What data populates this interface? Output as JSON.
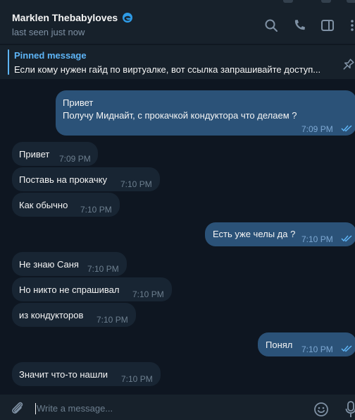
{
  "header": {
    "chat_name": "Marklen Thebabyloves",
    "status": "last seen just now"
  },
  "pinned": {
    "title": "Pinned message",
    "text": "Если кому нужен гайд по виртуалке, вот ссылка запрашивайте доступ..."
  },
  "messages": [
    {
      "direction": "out",
      "lines": [
        "Привет",
        "Получу Миднайт, с прокачкой кондуктора что делаем ?"
      ],
      "time": "7:09 PM",
      "read": true
    },
    {
      "direction": "in",
      "lines": [
        "Привет"
      ],
      "time": "7:09 PM"
    },
    {
      "direction": "in",
      "lines": [
        "Поставь на прокачку"
      ],
      "time": "7:10 PM"
    },
    {
      "direction": "in",
      "lines": [
        "Как обычно"
      ],
      "time": "7:10 PM"
    },
    {
      "direction": "out",
      "lines": [
        "Есть уже челы да ?"
      ],
      "time": "7:10 PM",
      "read": true
    },
    {
      "direction": "in",
      "lines": [
        "Не знаю Саня"
      ],
      "time": "7:10 PM"
    },
    {
      "direction": "in",
      "lines": [
        "Но никто не спрашивал"
      ],
      "time": "7:10 PM"
    },
    {
      "direction": "in",
      "lines": [
        "из кондукторов"
      ],
      "time": "7:10 PM"
    },
    {
      "direction": "out",
      "lines": [
        "Понял"
      ],
      "time": "7:10 PM",
      "read": true
    },
    {
      "direction": "in",
      "lines": [
        "Значит что-то нашли"
      ],
      "time": "7:10 PM"
    }
  ],
  "composer": {
    "placeholder": "Write a message..."
  },
  "icons": {
    "header": [
      "search-icon",
      "phone-icon",
      "sidebar-toggle-icon",
      "more-vertical-icon"
    ],
    "pinned": "pin-icon",
    "composer": [
      "attach-icon",
      "emoji-icon",
      "microphone-icon"
    ]
  },
  "colors": {
    "background": "#0e1621",
    "panel": "#17212b",
    "incoming_bubble": "#182533",
    "outgoing_bubble": "#2b5278",
    "accent": "#5eb5f7",
    "muted_text": "#7f91a4"
  }
}
